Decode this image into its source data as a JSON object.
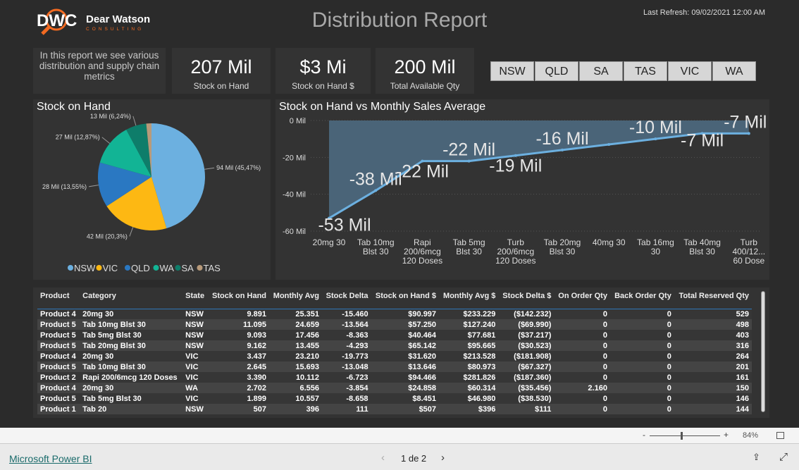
{
  "header": {
    "logo_text": "Dear Watson",
    "logo_sub": "CONSULTING",
    "logo_mark": "DWC",
    "title": "Distribution Report",
    "last_refresh": "Last Refresh: 09/02/2021 12:00 AM"
  },
  "intro": "In this report we see various distribution and supply chain metrics",
  "kpis": [
    {
      "value": "207 Mil",
      "label": "Stock on Hand"
    },
    {
      "value": "$3 Mi",
      "label": "Stock on Hand $"
    },
    {
      "value": "200 Mil",
      "label": "Total Available Qty"
    }
  ],
  "slicer": [
    "NSW",
    "QLD",
    "SA",
    "TAS",
    "VIC",
    "WA"
  ],
  "chart_data": [
    {
      "type": "pie",
      "title": "Stock on Hand",
      "categories": [
        "NSW",
        "VIC",
        "QLD",
        "WA",
        "SA",
        "TAS"
      ],
      "values": [
        45.47,
        20.3,
        13.55,
        12.87,
        6.24,
        1.57
      ],
      "labels": [
        "94 Mil (45,47%)",
        "42 Mil (20,3%)",
        "28 Mil (13,55%)",
        "27 Mil (12,87%)",
        "13 Mil (6,24%)",
        ""
      ],
      "colors": [
        "#6cb0e0",
        "#fdb813",
        "#2a78c2",
        "#12b495",
        "#0e7d6a",
        "#b89a7a"
      ],
      "legend": "bottom"
    },
    {
      "type": "area",
      "title": "Stock on Hand vs Monthly Sales Average",
      "categories": [
        "20mg 30",
        "Tab 10mg Blst 30",
        "Rapi 200/6mcg 120 Doses",
        "Tab 5mg Blst 30",
        "Turb 200/6mcg 120 Doses",
        "Tab 20mg Blst 30",
        "40mg 30",
        "Tab 16mg 30",
        "Tab 40mg Blst 30",
        "Turb 400/12... 60 Dose"
      ],
      "values": [
        -53,
        -38,
        -22,
        -22,
        -19,
        -16,
        -13,
        -10,
        -7,
        -7
      ],
      "labels": [
        "-53 Mil",
        "-38 Mil",
        "-22 Mil",
        "-22 Mil",
        "-19 Mil",
        "-16 Mil",
        "",
        "-10 Mil",
        "-7 Mil",
        "-7 Mil"
      ],
      "yticks": [
        "0 Mil",
        "-20 Mil",
        "-40 Mil",
        "-60 Mil"
      ],
      "ylim": [
        -60,
        0
      ],
      "grid": true,
      "line_color": "#6cb0e0",
      "area_color": "#4a6478"
    }
  ],
  "table": {
    "columns": [
      "Product",
      "Category",
      "State",
      "Stock on Hand",
      "Monthly Avg",
      "Stock Delta",
      "Stock on Hand $",
      "Monthly Avg $",
      "Stock Delta $",
      "On Order Qty",
      "Back Order Qty",
      "Total Reserved Qty"
    ],
    "rows": [
      [
        "Product 4",
        "20mg 30",
        "NSW",
        "9.891",
        "25.351",
        "-15.460",
        "$90.997",
        "$233.229",
        "($142.232)",
        "0",
        "0",
        "529"
      ],
      [
        "Product 5",
        "Tab 10mg Blst 30",
        "NSW",
        "11.095",
        "24.659",
        "-13.564",
        "$57.250",
        "$127.240",
        "($69.990)",
        "0",
        "0",
        "498"
      ],
      [
        "Product 5",
        "Tab 5mg Blst 30",
        "NSW",
        "9.093",
        "17.456",
        "-8.363",
        "$40.464",
        "$77.681",
        "($37.217)",
        "0",
        "0",
        "403"
      ],
      [
        "Product 5",
        "Tab 20mg Blst 30",
        "NSW",
        "9.162",
        "13.455",
        "-4.293",
        "$65.142",
        "$95.665",
        "($30.523)",
        "0",
        "0",
        "316"
      ],
      [
        "Product 4",
        "20mg 30",
        "VIC",
        "3.437",
        "23.210",
        "-19.773",
        "$31.620",
        "$213.528",
        "($181.908)",
        "0",
        "0",
        "264"
      ],
      [
        "Product 5",
        "Tab 10mg Blst 30",
        "VIC",
        "2.645",
        "15.693",
        "-13.048",
        "$13.646",
        "$80.973",
        "($67.327)",
        "0",
        "0",
        "201"
      ],
      [
        "Product 2",
        "Rapi 200/6mcg 120 Doses",
        "VIC",
        "3.390",
        "10.112",
        "-6.723",
        "$94.466",
        "$281.826",
        "($187.360)",
        "0",
        "0",
        "161"
      ],
      [
        "Product 4",
        "20mg 30",
        "WA",
        "2.702",
        "6.556",
        "-3.854",
        "$24.858",
        "$60.314",
        "($35.456)",
        "2.160",
        "0",
        "150"
      ],
      [
        "Product 5",
        "Tab 5mg Blst 30",
        "VIC",
        "1.899",
        "10.557",
        "-8.658",
        "$8.451",
        "$46.980",
        "($38.530)",
        "0",
        "0",
        "146"
      ],
      [
        "Product 1",
        "Tab 20",
        "NSW",
        "507",
        "396",
        "111",
        "$507",
        "$396",
        "$111",
        "0",
        "0",
        "144"
      ]
    ]
  },
  "toolbar": {
    "zoom_minus": "-",
    "zoom_plus": "+",
    "zoom_level": "84%",
    "zoom_value": 0.45
  },
  "footer": {
    "brand_link": "Microsoft Power BI",
    "page_indicator": "1 de 2"
  }
}
